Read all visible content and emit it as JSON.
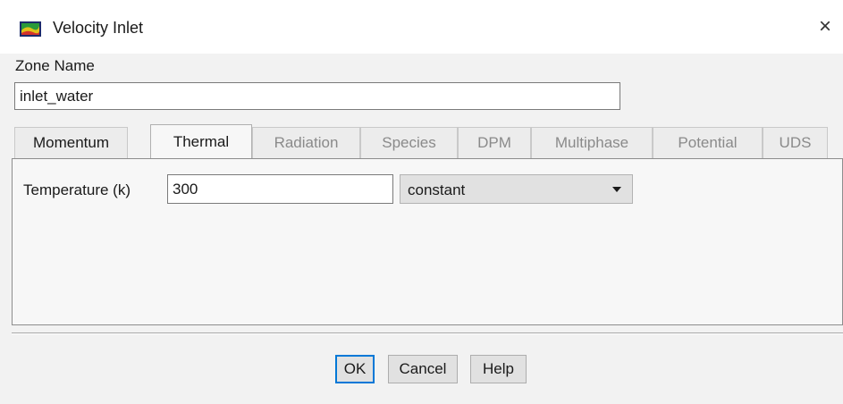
{
  "window": {
    "title": "Velocity Inlet",
    "close_glyph": "×",
    "icon": "fluent-app-icon"
  },
  "zone": {
    "label": "Zone Name",
    "value": "inlet_water"
  },
  "tabs": [
    {
      "label": "Momentum",
      "state": "enabled"
    },
    {
      "label": "Thermal",
      "state": "active"
    },
    {
      "label": "Radiation",
      "state": "disabled"
    },
    {
      "label": "Species",
      "state": "disabled"
    },
    {
      "label": "DPM",
      "state": "disabled"
    },
    {
      "label": "Multiphase",
      "state": "disabled"
    },
    {
      "label": "Potential",
      "state": "disabled"
    },
    {
      "label": "UDS",
      "state": "disabled"
    }
  ],
  "thermal": {
    "temperature_label": "Temperature (k)",
    "temperature_value": "300",
    "method_value": "constant",
    "method_icon": "chevron-down-icon"
  },
  "buttons": {
    "ok": "OK",
    "cancel": "Cancel",
    "help": "Help"
  },
  "colors": {
    "default_button_border": "#0078d7",
    "dialog_background": "#f2f2f2"
  }
}
